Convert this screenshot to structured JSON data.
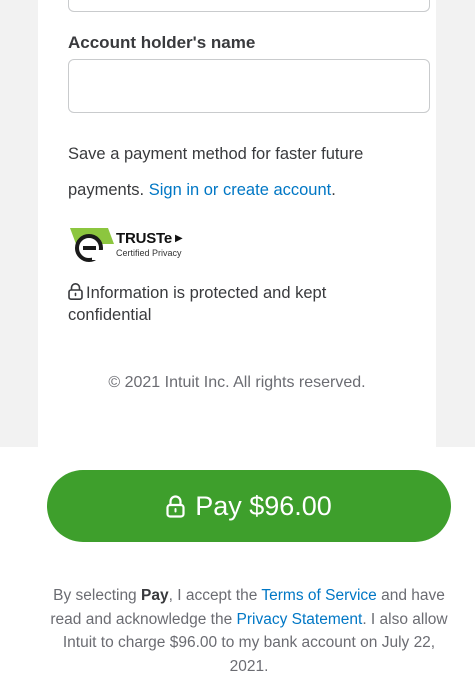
{
  "form": {
    "account_holder_label": "Account holder's name",
    "account_holder_value": "",
    "save_text": "Save a payment method for faster future payments.",
    "sign_in_link": "Sign in or create account",
    "save_text_end": "."
  },
  "trust": {
    "brand": "TRUSTe",
    "sub": "Certified Privacy"
  },
  "security": {
    "text": "Information is protected and kept confidential"
  },
  "footer": {
    "copyright": "© 2021 Intuit Inc. All rights reserved."
  },
  "pay_button": {
    "label": "Pay $96.00"
  },
  "legal": {
    "part1": "By selecting ",
    "bold": "Pay",
    "part2": ", I accept the ",
    "terms_link": "Terms of Service",
    "part3": " and have read and acknowledge the ",
    "privacy_link": "Privacy Statement",
    "part4": ". I also allow Intuit to charge $96.00 to my bank account on July 22, 2021."
  },
  "colors": {
    "accent_green": "#3e9f2c",
    "link_blue": "#0077c5",
    "truste_green": "#8cc63f"
  }
}
